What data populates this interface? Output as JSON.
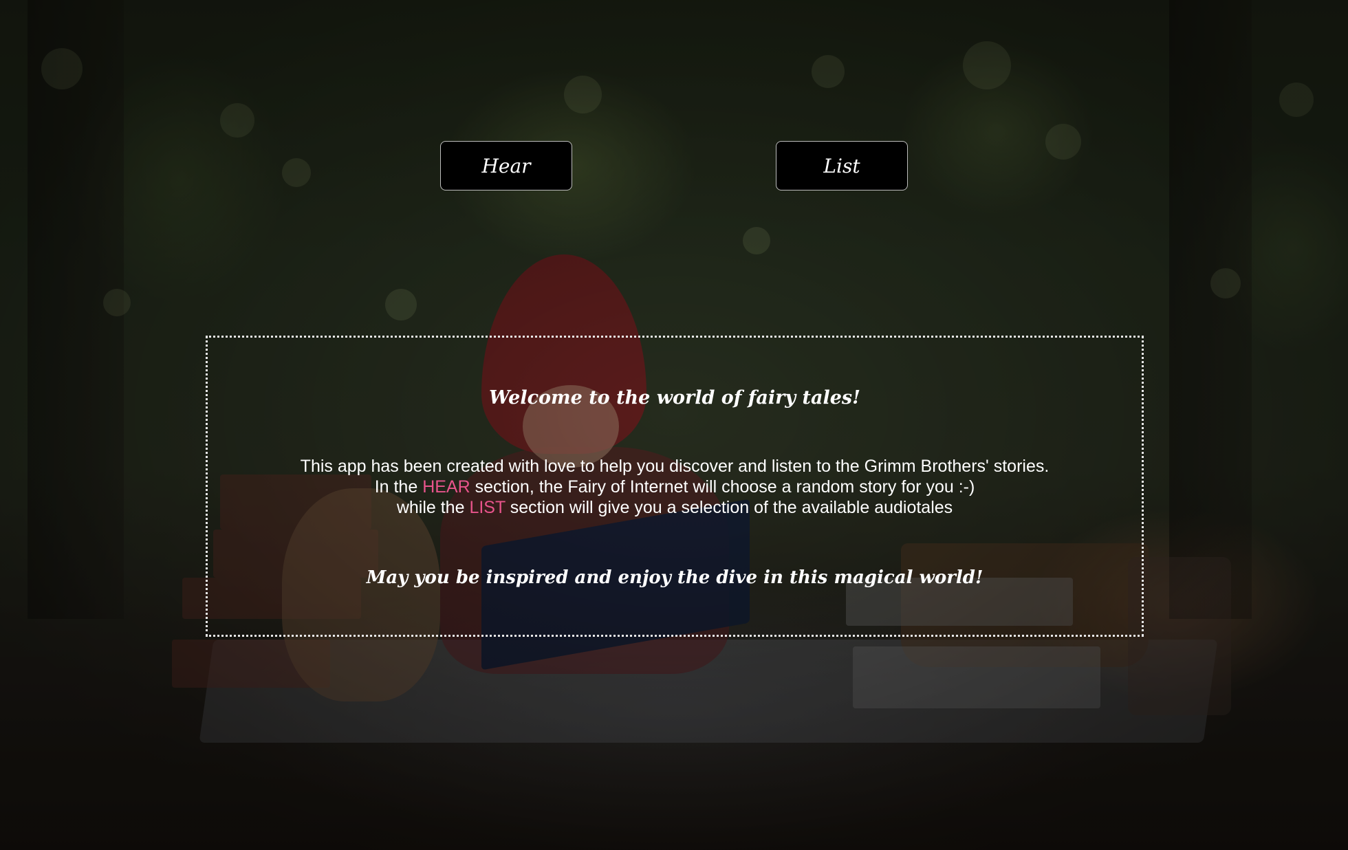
{
  "nav": {
    "hear_label": "Hear",
    "list_label": "List"
  },
  "welcome": {
    "title": "Welcome to the world of fairy tales!",
    "line1": "This app has been created with love to help you discover and listen to the Grimm Brothers' stories.",
    "line2_before": "In the ",
    "line2_highlight": "HEAR",
    "line2_after": " section, the Fairy of Internet will choose a random story for you :-)",
    "line3_before": "while the ",
    "line3_highlight": "LIST",
    "line3_after": " section will give you a selection of the available audiotales",
    "footer": "May you be inspired and enjoy the dive in this magical world!"
  },
  "colors": {
    "highlight": "#e8548c",
    "button_bg": "#000000",
    "box_border": "#e9e9e9"
  }
}
